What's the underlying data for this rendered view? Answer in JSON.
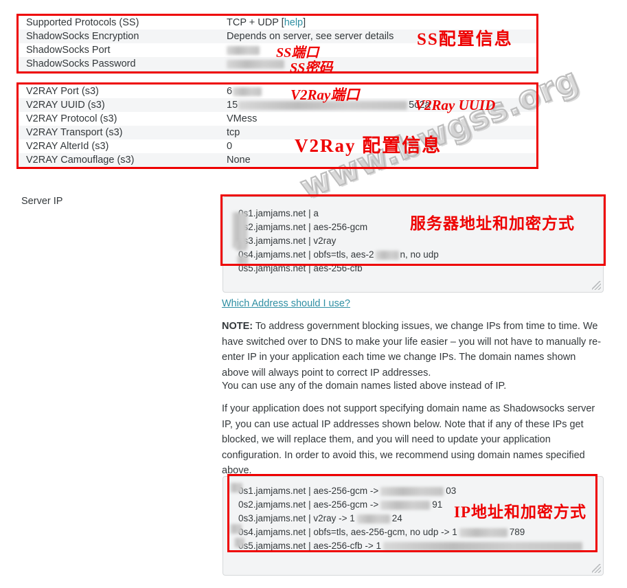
{
  "watermark": {
    "text": "www.bwgss.org"
  },
  "ss_section": {
    "rows": [
      {
        "label": "Supported Protocols (SS)",
        "value": "TCP + UDP [",
        "link": "help",
        "value_tail": "]"
      },
      {
        "label": "ShadowSocks Encryption",
        "value": "Depends on server, see server details"
      },
      {
        "label": "ShadowSocks Port",
        "value": ""
      },
      {
        "label": "ShadowSocks Password",
        "value": ""
      }
    ],
    "annotations": {
      "title": "SS配置信息",
      "port": "SS端口",
      "password": "SS密码"
    }
  },
  "v2ray_section": {
    "rows": [
      {
        "label": "V2RAY Port (s3)",
        "value": "6"
      },
      {
        "label": "V2RAY UUID (s3)",
        "value": "15",
        "value_tail": "5c2a"
      },
      {
        "label": "V2RAY Protocol (s3)",
        "value": "VMess"
      },
      {
        "label": "V2RAY Transport (s3)",
        "value": "tcp"
      },
      {
        "label": "V2RAY AlterId (s3)",
        "value": "0"
      },
      {
        "label": "V2RAY Camouflage (s3)",
        "value": "None"
      }
    ],
    "annotations": {
      "port": "V2Ray端口",
      "uuid": "V2Ray UUID",
      "title": "V2Ray 配置信息"
    }
  },
  "server_ip": {
    "label": "Server IP",
    "annotation": "服务器地址和加密方式",
    "lines": [
      {
        "prefix": "0s1.jamjams.net",
        "sep": "|",
        "rest": "a"
      },
      {
        "prefix": "0s2.jamjams.net",
        "sep": "|",
        "rest": "aes-256-gcm"
      },
      {
        "prefix": "0s3.jamjams.net",
        "sep": "|",
        "rest": "v2ray"
      },
      {
        "prefix": "0s4.jamjams.net",
        "sep": "|",
        "rest": "obfs=tls, aes-2",
        "rest2": "n, no udp"
      },
      {
        "prefix": "0s5.jamjams.net",
        "sep": "|",
        "rest": "aes-256-cfb"
      }
    ]
  },
  "which_address_link": "Which Address should I use?",
  "paragraphs": {
    "note_label": "NOTE:",
    "note_body": " To address government blocking issues, we change IPs from time to time. We have switched over to DNS to make your life easier – you will not have to manually re-enter IP in your application each time we change IPs. The domain names shown above will always point to correct IP addresses.",
    "p2": "You can use any of the domain names listed above instead of IP.",
    "p3": "If your application does not support specifying domain name as Shadowsocks server IP, you can use actual IP addresses shown below. Note that if any of these IPs get blocked, we will replace them, and you will need to update your application configuration. In order to avoid this, we recommend using domain names specified above."
  },
  "ip_box": {
    "annotation": "IP地址和加密方式",
    "lines": [
      {
        "prefix": "0s1.jamjams.net",
        "sep": "|",
        "mid": "aes-256-gcm ->",
        "tail": "03"
      },
      {
        "prefix": "0s2.jamjams.net",
        "sep": "|",
        "mid": "aes-256-gcm ->",
        "tail": "91"
      },
      {
        "prefix": "0s3.jamjams.net",
        "sep": "|",
        "mid": "v2ray -> 1",
        "tail": "24"
      },
      {
        "prefix": "0s4.jamjams.net",
        "sep": "|",
        "mid": "obfs=tls, aes-256-gcm, no udp -> 1",
        "tail": "789"
      },
      {
        "prefix": "0s5.jamjams.net",
        "sep": "|",
        "mid": "aes-256-cfb -> 1",
        "tail": ""
      }
    ]
  },
  "colors": {
    "annotation_red": "#ee0000",
    "link_teal": "#2f8fa3",
    "text": "#33383b",
    "field_bg": "#f3f4f5"
  }
}
